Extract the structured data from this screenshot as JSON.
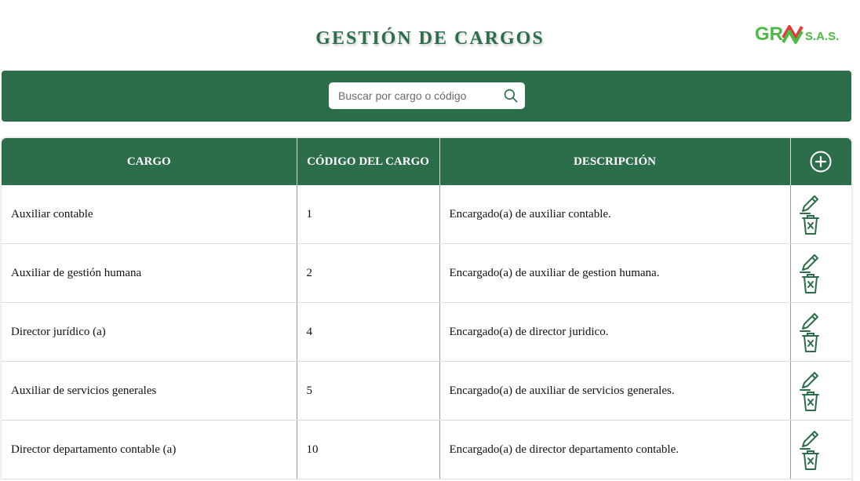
{
  "header": {
    "title": "GESTIÓN DE CARGOS",
    "logo_text_left": "GR",
    "logo_text_right": "S.A.S."
  },
  "search": {
    "placeholder": "Buscar por cargo o código",
    "value": ""
  },
  "table": {
    "columns": [
      "CARGO",
      "CÓDIGO DEL CARGO",
      "DESCRIPCIÓN"
    ],
    "rows": [
      {
        "cargo": "Auxiliar contable",
        "codigo": "1",
        "descripcion": "Encargado(a) de auxiliar contable."
      },
      {
        "cargo": "Auxiliar de gestión humana",
        "codigo": "2",
        "descripcion": "Encargado(a) de auxiliar de gestion humana."
      },
      {
        "cargo": "Director jurídico (a)",
        "codigo": "4",
        "descripcion": "Encargado(a) de director juridico."
      },
      {
        "cargo": "Auxiliar de servicios generales",
        "codigo": "5",
        "descripcion": "Encargado(a) de auxiliar de servicios generales."
      },
      {
        "cargo": "Director departamento contable (a)",
        "codigo": "10",
        "descripcion": "Encargado(a) de director departamento contable."
      }
    ]
  },
  "icons": {
    "add": "plus-circle-icon",
    "edit": "pencil-icon",
    "delete": "trash-icon",
    "search": "search-icon"
  },
  "colors": {
    "primary": "#2c6e49",
    "logo_green": "#4cbb47",
    "logo_red": "#e53935"
  }
}
